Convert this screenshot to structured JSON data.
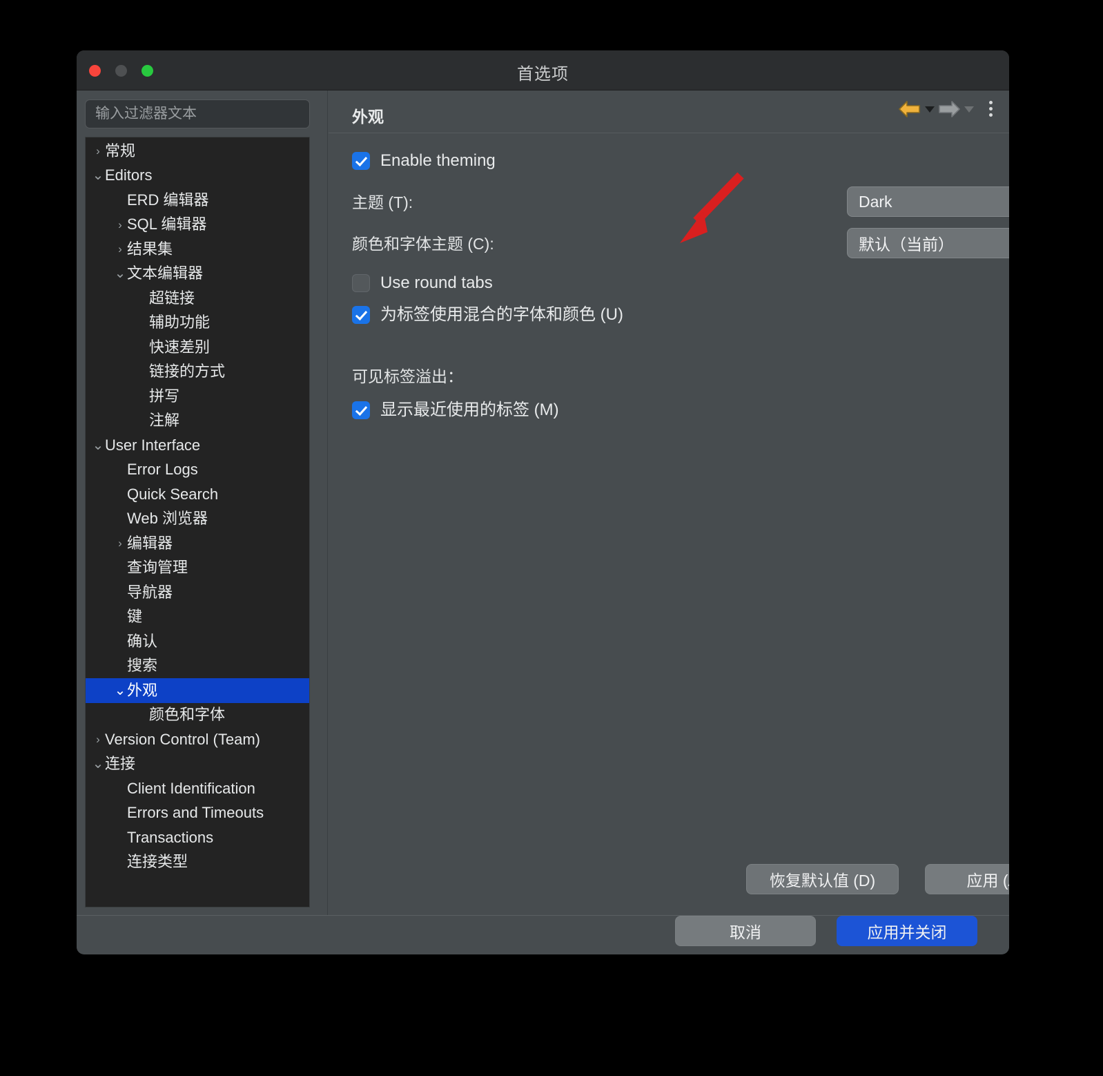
{
  "window": {
    "title": "首选项",
    "traffic_lights": [
      "close",
      "minimize",
      "zoom"
    ]
  },
  "sidebar": {
    "filter_placeholder": "输入过滤器文本",
    "filter_value": "",
    "items": [
      {
        "label": "常规",
        "indent": 0,
        "twisty": "collapsed",
        "selected": false
      },
      {
        "label": "Editors",
        "indent": 0,
        "twisty": "expanded",
        "selected": false
      },
      {
        "label": "ERD 编辑器",
        "indent": 1,
        "twisty": "none",
        "selected": false
      },
      {
        "label": "SQL 编辑器",
        "indent": 1,
        "twisty": "collapsed",
        "selected": false
      },
      {
        "label": "结果集",
        "indent": 1,
        "twisty": "collapsed",
        "selected": false
      },
      {
        "label": "文本编辑器",
        "indent": 1,
        "twisty": "expanded",
        "selected": false
      },
      {
        "label": "超链接",
        "indent": 2,
        "twisty": "none",
        "selected": false
      },
      {
        "label": "辅助功能",
        "indent": 2,
        "twisty": "none",
        "selected": false
      },
      {
        "label": "快速差别",
        "indent": 2,
        "twisty": "none",
        "selected": false
      },
      {
        "label": "链接的方式",
        "indent": 2,
        "twisty": "none",
        "selected": false
      },
      {
        "label": "拼写",
        "indent": 2,
        "twisty": "none",
        "selected": false
      },
      {
        "label": "注解",
        "indent": 2,
        "twisty": "none",
        "selected": false
      },
      {
        "label": "User Interface",
        "indent": 0,
        "twisty": "expanded",
        "selected": false
      },
      {
        "label": "Error Logs",
        "indent": 1,
        "twisty": "none",
        "selected": false
      },
      {
        "label": "Quick Search",
        "indent": 1,
        "twisty": "none",
        "selected": false
      },
      {
        "label": "Web 浏览器",
        "indent": 1,
        "twisty": "none",
        "selected": false
      },
      {
        "label": "编辑器",
        "indent": 1,
        "twisty": "collapsed",
        "selected": false
      },
      {
        "label": "查询管理",
        "indent": 1,
        "twisty": "none",
        "selected": false
      },
      {
        "label": "导航器",
        "indent": 1,
        "twisty": "none",
        "selected": false
      },
      {
        "label": "键",
        "indent": 1,
        "twisty": "none",
        "selected": false
      },
      {
        "label": "确认",
        "indent": 1,
        "twisty": "none",
        "selected": false
      },
      {
        "label": "搜索",
        "indent": 1,
        "twisty": "none",
        "selected": false
      },
      {
        "label": "外观",
        "indent": 1,
        "twisty": "expanded",
        "selected": true
      },
      {
        "label": "颜色和字体",
        "indent": 2,
        "twisty": "none",
        "selected": false
      },
      {
        "label": "Version Control (Team)",
        "indent": 0,
        "twisty": "collapsed",
        "selected": false
      },
      {
        "label": "连接",
        "indent": 0,
        "twisty": "expanded",
        "selected": false
      },
      {
        "label": "Client Identification",
        "indent": 1,
        "twisty": "none",
        "selected": false
      },
      {
        "label": "Errors and Timeouts",
        "indent": 1,
        "twisty": "none",
        "selected": false
      },
      {
        "label": "Transactions",
        "indent": 1,
        "twisty": "none",
        "selected": false
      },
      {
        "label": "连接类型",
        "indent": 1,
        "twisty": "none",
        "selected": false
      }
    ]
  },
  "page": {
    "title": "外观",
    "toolbar": {
      "back_icon": "back-arrow-icon",
      "forward_icon": "forward-arrow-icon",
      "menu_icon": "kebab-menu-icon"
    },
    "enable_theming": {
      "label": "Enable theming",
      "checked": true
    },
    "theme": {
      "label": "主题 (T):",
      "value": "Dark"
    },
    "color_font_theme": {
      "label": "颜色和字体主题 (C):",
      "value": "默认（当前）"
    },
    "round_tabs": {
      "label": "Use round tabs",
      "checked": false
    },
    "mixed_fonts": {
      "label": "为标签使用混合的字体和颜色 (U)",
      "checked": true
    },
    "tab_overflow_section": "可见标签溢出：",
    "recent_tabs": {
      "label": "显示最近使用的标签 (M)",
      "checked": true
    },
    "restore_defaults_label": "恢复默认值 (D)",
    "apply_label": "应用 (A)"
  },
  "footer": {
    "cancel_label": "取消",
    "apply_close_label": "应用并关闭"
  },
  "annotation": {
    "type": "red-arrow",
    "color": "#d91f1f",
    "points_at": "theme-select"
  },
  "colors": {
    "window_bg": "#474c4f",
    "titlebar_bg": "#2c2e30",
    "tree_bg": "#232323",
    "selection_blue": "#0d41c6",
    "accent_blue": "#1a73e8",
    "primary_button_blue": "#1c54d6",
    "annotation_red": "#d91f1f"
  }
}
